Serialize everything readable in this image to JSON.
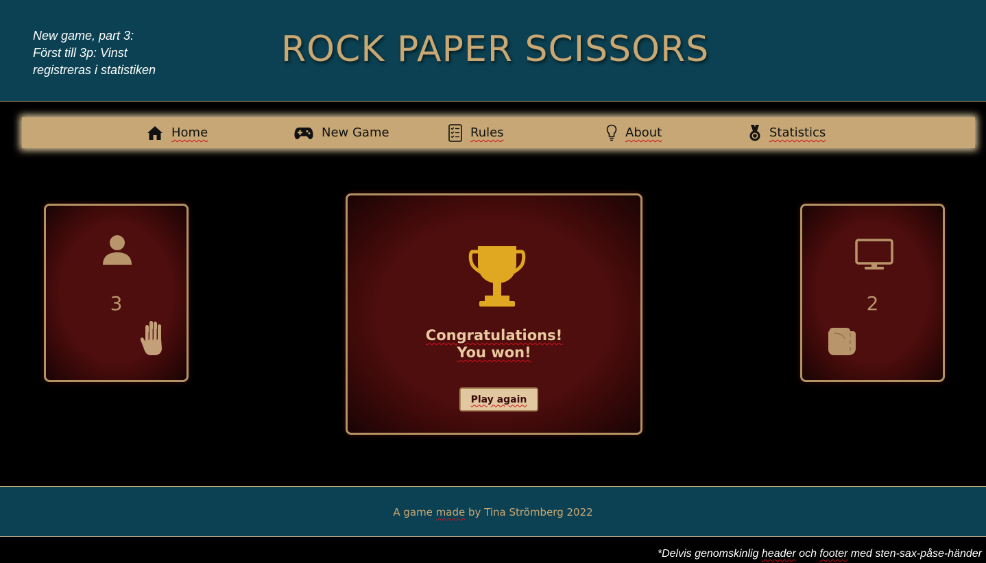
{
  "header": {
    "note_lines": [
      "New game, part 3:",
      "Först till 3p: Vinst",
      "registreras i  statistiken"
    ],
    "title": "ROCK PAPER SCISSORS"
  },
  "nav": {
    "items": [
      {
        "label": "Home",
        "icon": "home-icon"
      },
      {
        "label": "New Game",
        "icon": "gamepad-icon"
      },
      {
        "label": "Rules",
        "icon": "checklist-icon"
      },
      {
        "label": "About",
        "icon": "lightbulb-icon"
      },
      {
        "label": "Statistics",
        "icon": "medal-icon"
      }
    ]
  },
  "game": {
    "player": {
      "icon": "user-icon",
      "score": "3",
      "hand_icon": "paper-hand-icon"
    },
    "computer": {
      "icon": "monitor-icon",
      "score": "2",
      "hand_icon": "rock-fist-icon"
    },
    "result": {
      "icon": "trophy-icon",
      "line1": "Congratulations!",
      "line2": "You won!",
      "button": "Play again"
    }
  },
  "footer": {
    "pre": "A game ",
    "made": "made",
    "post": " by Tina Strömberg 2022"
  },
  "bottom_note": {
    "pre": "*Delvis genomskinlig ",
    "header": "header",
    "mid": " och ",
    "footer": "footer",
    "post": " med sten-sax-påse-händer"
  },
  "colors": {
    "header_bg": "#0b4152",
    "accent_gold": "#c9a873",
    "nav_bg": "#c6a775",
    "card_red": "#4f0e0e",
    "trophy": "#e0a820"
  }
}
